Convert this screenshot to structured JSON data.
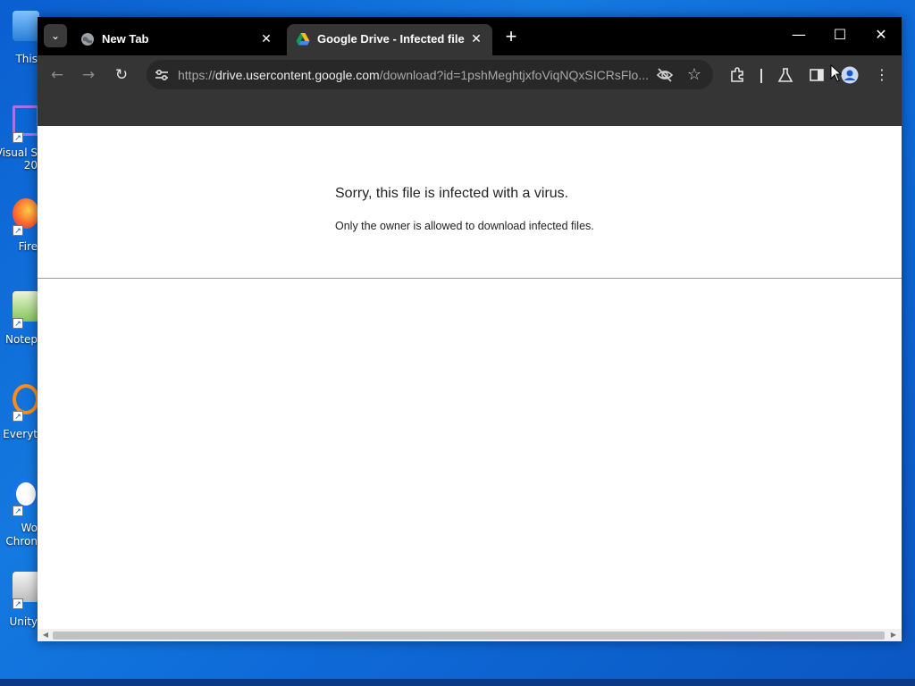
{
  "desktop": {
    "icons": [
      {
        "name": "this-pc",
        "label": "This"
      },
      {
        "name": "visual-studio",
        "label": "Visual S",
        "label2": "20"
      },
      {
        "name": "firefox",
        "label": "Fire"
      },
      {
        "name": "notepad",
        "label": "Notep"
      },
      {
        "name": "everything",
        "label": "Everyt"
      },
      {
        "name": "chrome",
        "label": "Wo",
        "label2": "Chron"
      },
      {
        "name": "unity",
        "label": "Unity"
      }
    ]
  },
  "browser": {
    "tabs": [
      {
        "title": "New Tab",
        "active": false
      },
      {
        "title": "Google Drive - Infected file",
        "active": true
      }
    ],
    "address_bar": {
      "url_prefix": "https://",
      "url_host": "drive.usercontent.google.com",
      "url_path": "/download?id=1pshMeghtjxfoViqNQxSICRsFlo..."
    },
    "window_controls": {
      "minimize": "—",
      "maximize": "☐",
      "close": "✕"
    }
  },
  "page": {
    "error_title": "Sorry, this file is infected with a virus.",
    "error_message": "Only the owner is allowed to download infected files."
  },
  "colors": {
    "tabbar_bg": "#000000",
    "toolbar_bg": "#353535",
    "omnibox_bg": "#282828",
    "desktop_blue": "#1479e0"
  }
}
